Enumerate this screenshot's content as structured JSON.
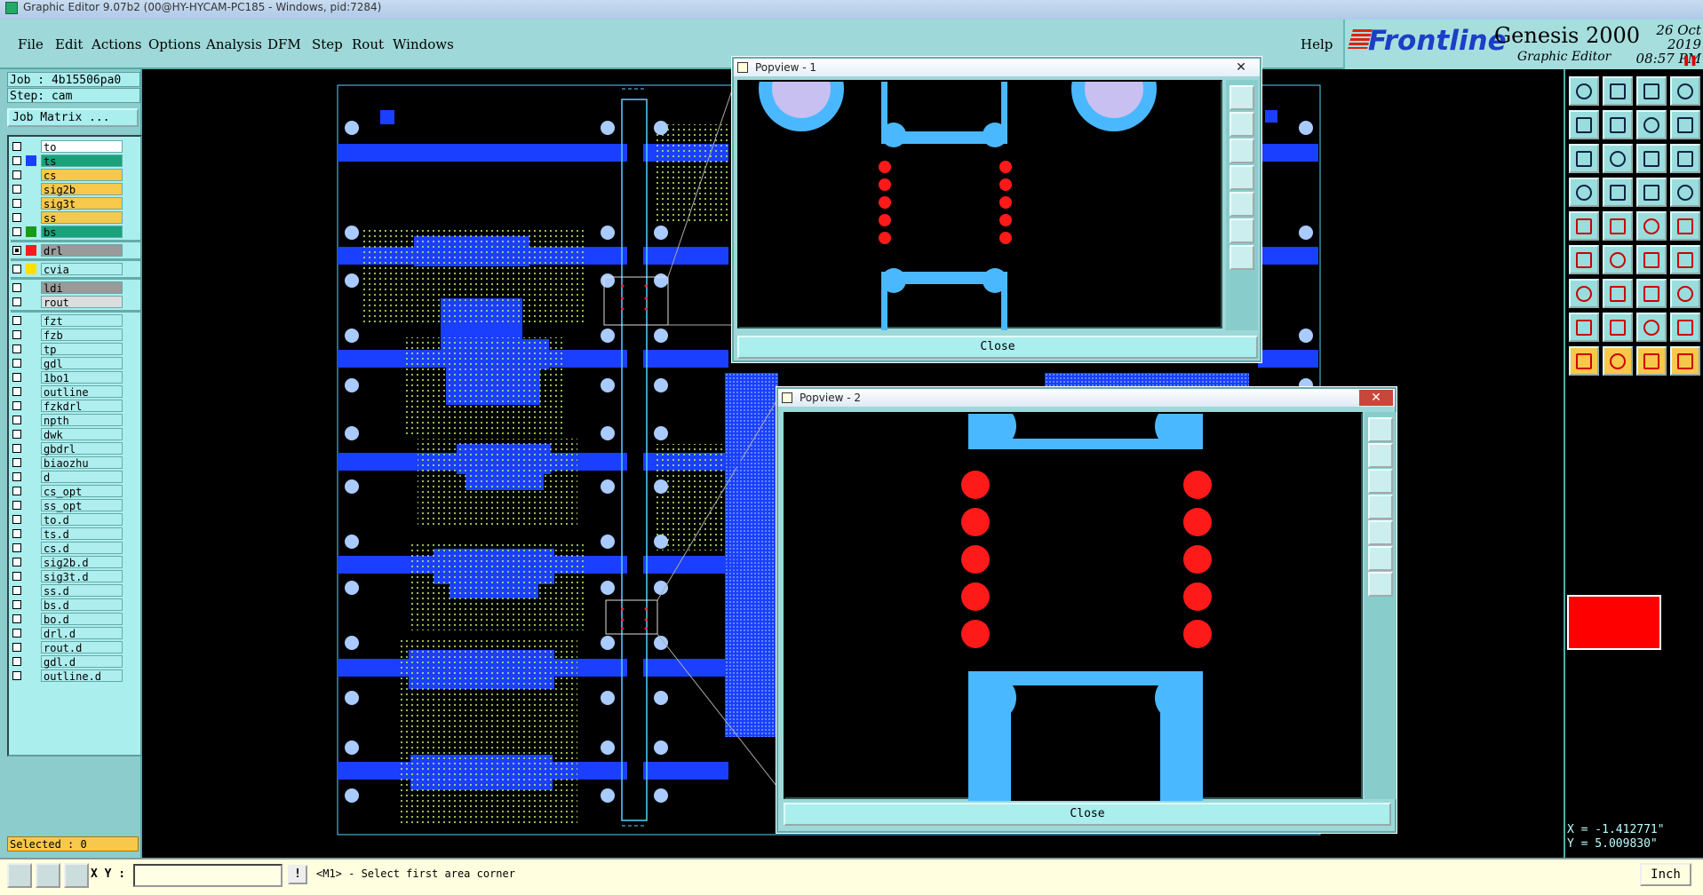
{
  "window": {
    "title": "Graphic Editor 9.07b2 (00@HY-HYCAM-PC185 - Windows, pid:7284)"
  },
  "menu": {
    "items": [
      "File",
      "Edit",
      "Actions",
      "Options",
      "Analysis",
      "DFM",
      "Step",
      "Rout",
      "Windows"
    ],
    "help": "Help"
  },
  "brand": {
    "logo": "Frontline",
    "product": "Genesis 2000",
    "subtitle": "Graphic Editor",
    "date": "26 Oct 2019",
    "time": "08:57 PM",
    "pause_icon": "pause-icon"
  },
  "job": {
    "job_label": "Job : 4b15506pa0",
    "step_label": "Step: cam",
    "matrix_button": "Job Matrix ..."
  },
  "layers": [
    {
      "name": "to",
      "color": "#ffffff",
      "swatch": ""
    },
    {
      "name": "ts",
      "color": "#1aa27a",
      "swatch": "#1a3fff"
    },
    {
      "name": "cs",
      "color": "#f7c84a",
      "swatch": ""
    },
    {
      "name": "sig2b",
      "color": "#f7c84a",
      "swatch": ""
    },
    {
      "name": "sig3t",
      "color": "#f7c84a",
      "swatch": ""
    },
    {
      "name": "ss",
      "color": "#f7c84a",
      "swatch": ""
    },
    {
      "name": "bs",
      "color": "#1aa27a",
      "swatch": "#1a9a1a"
    },
    {
      "name": "drl",
      "color": "#9a9a9a",
      "swatch": "#ff1a1a"
    },
    {
      "name": "cvia",
      "color": "#aeeeee",
      "swatch": "#ffe000"
    },
    {
      "name": "ldi",
      "color": "#9a9a9a",
      "swatch": ""
    },
    {
      "name": "rout",
      "color": "#dddddd",
      "swatch": ""
    },
    {
      "name": "fzt",
      "color": "#aeeeee",
      "swatch": ""
    },
    {
      "name": "fzb",
      "color": "#aeeeee",
      "swatch": ""
    },
    {
      "name": "tp",
      "color": "#aeeeee",
      "swatch": ""
    },
    {
      "name": "gdl",
      "color": "#aeeeee",
      "swatch": ""
    },
    {
      "name": "1bo1",
      "color": "#aeeeee",
      "swatch": ""
    },
    {
      "name": "outline",
      "color": "#aeeeee",
      "swatch": ""
    },
    {
      "name": "fzkdrl",
      "color": "#aeeeee",
      "swatch": ""
    },
    {
      "name": "npth",
      "color": "#aeeeee",
      "swatch": ""
    },
    {
      "name": "dwk",
      "color": "#aeeeee",
      "swatch": ""
    },
    {
      "name": "gbdrl",
      "color": "#aeeeee",
      "swatch": ""
    },
    {
      "name": "biaozhu",
      "color": "#aeeeee",
      "swatch": ""
    },
    {
      "name": "d",
      "color": "#aeeeee",
      "swatch": ""
    },
    {
      "name": "cs_opt",
      "color": "#aeeeee",
      "swatch": ""
    },
    {
      "name": "ss_opt",
      "color": "#aeeeee",
      "swatch": ""
    },
    {
      "name": "to.d",
      "color": "#aeeeee",
      "swatch": ""
    },
    {
      "name": "ts.d",
      "color": "#aeeeee",
      "swatch": ""
    },
    {
      "name": "cs.d",
      "color": "#aeeeee",
      "swatch": ""
    },
    {
      "name": "sig2b.d",
      "color": "#aeeeee",
      "swatch": ""
    },
    {
      "name": "sig3t.d",
      "color": "#aeeeee",
      "swatch": ""
    },
    {
      "name": "ss.d",
      "color": "#aeeeee",
      "swatch": ""
    },
    {
      "name": "bs.d",
      "color": "#aeeeee",
      "swatch": ""
    },
    {
      "name": "bo.d",
      "color": "#aeeeee",
      "swatch": ""
    },
    {
      "name": "drl.d",
      "color": "#aeeeee",
      "swatch": ""
    },
    {
      "name": "rout.d",
      "color": "#aeeeee",
      "swatch": ""
    },
    {
      "name": "gdl.d",
      "color": "#aeeeee",
      "swatch": ""
    },
    {
      "name": "outline.d",
      "color": "#aeeeee",
      "swatch": ""
    }
  ],
  "selected": "Selected : 0",
  "popview1": {
    "title": "Popview - 1",
    "close_label": "Close",
    "close_glyph": "✕"
  },
  "popview2": {
    "title": "Popview - 2",
    "close_label": "Close",
    "close_glyph": "✕"
  },
  "coords": {
    "x": "X = -1.412771\"",
    "y": "Y = 5.009830\""
  },
  "status": {
    "xy_label": "X Y :",
    "xy_value": "",
    "warn": "!",
    "prompt": "<M1> - Select first area corner",
    "units": "Inch"
  },
  "colors": {
    "copper": "#1a3fff",
    "pad": "#a9cbff",
    "drill": "#ff1a1a",
    "smd": "#4ab8ff",
    "outline": "#5ccfff"
  }
}
